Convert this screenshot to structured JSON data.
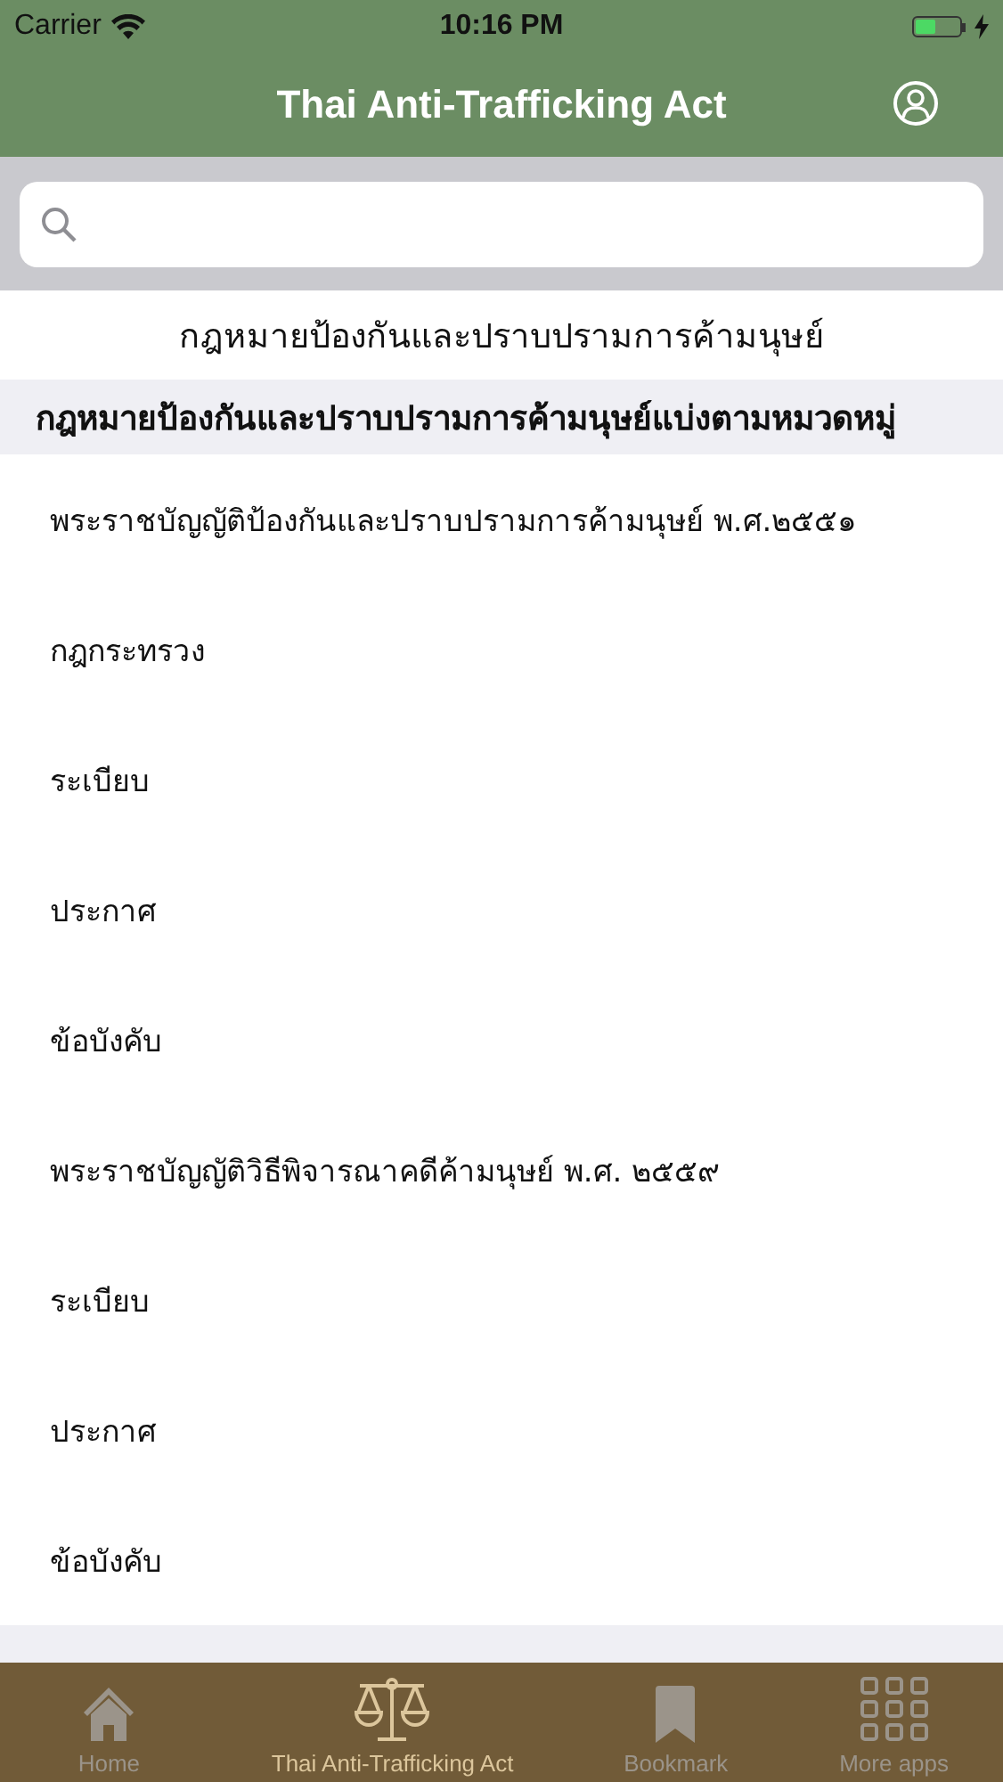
{
  "status_bar": {
    "carrier": "Carrier",
    "time": "10:16 PM",
    "charging": true
  },
  "nav_bar": {
    "title": "Thai Anti-Trafficking Act"
  },
  "page_title": "กฎหมายป้องกันและปราบปรามการค้ามนุษย์",
  "sections": [
    {
      "header": "กฎหมายป้องกันและปราบปรามการค้ามนุษย์แบ่งตามหมวดหมู่",
      "rows": [
        {
          "label": "พระราชบัญญัติป้องกันและปราบปรามการค้ามนุษย์ พ.ศ.๒๕๕๑"
        },
        {
          "label": "กฎกระทรวง"
        },
        {
          "label": "ระเบียบ"
        },
        {
          "label": "ประกาศ"
        },
        {
          "label": "ข้อบังคับ"
        },
        {
          "label": "พระราชบัญญัติวิธีพิจารณาคดีค้ามนุษย์ พ.ศ. ๒๕๕๙"
        },
        {
          "label": "ระเบียบ"
        },
        {
          "label": "ประกาศ"
        },
        {
          "label": "ข้อบังคับ"
        }
      ]
    }
  ],
  "tabs": [
    {
      "kind": "home",
      "label": "Home",
      "selected": false
    },
    {
      "kind": "scales",
      "label": "Thai Anti-Trafficking Act",
      "selected": true
    },
    {
      "kind": "bookmark",
      "label": "Bookmark",
      "selected": false
    },
    {
      "kind": "grid",
      "label": "More apps",
      "selected": false
    }
  ]
}
